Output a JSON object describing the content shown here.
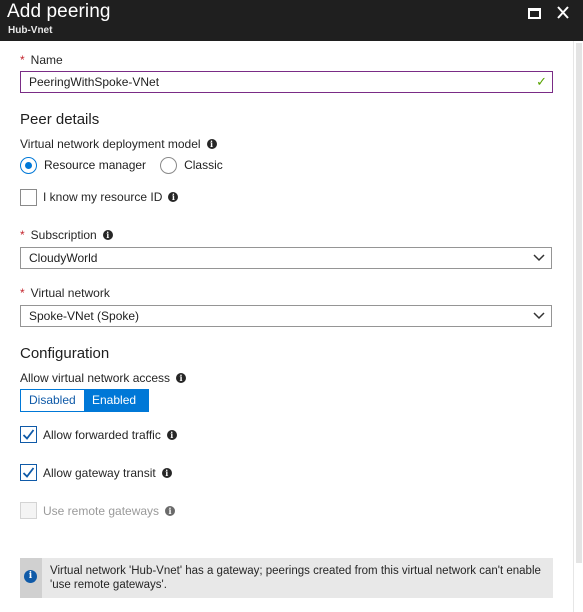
{
  "header": {
    "title": "Add peering",
    "subtitle": "Hub-Vnet"
  },
  "name_field": {
    "label": "Name",
    "required": "*",
    "value": "PeeringWithSpoke-VNet"
  },
  "peer_details": {
    "heading": "Peer details",
    "deployment_model_label": "Virtual network deployment model",
    "options": [
      "Resource manager",
      "Classic"
    ],
    "selected": "Resource manager",
    "resource_id_label": "I know my resource ID",
    "resource_id_checked": false,
    "subscription": {
      "label": "Subscription",
      "required": "*",
      "value": "CloudyWorld"
    },
    "virtual_network": {
      "label": "Virtual network",
      "required": "*",
      "value": "Spoke-VNet (Spoke)"
    }
  },
  "configuration": {
    "heading": "Configuration",
    "access_label": "Allow virtual network access",
    "toggle": {
      "off_label": "Disabled",
      "on_label": "Enabled",
      "selected": "Enabled"
    },
    "forwarded_traffic": {
      "label": "Allow forwarded traffic",
      "checked": true
    },
    "gateway_transit": {
      "label": "Allow gateway transit",
      "checked": true
    },
    "remote_gateways": {
      "label": "Use remote gateways",
      "checked": false,
      "disabled": true
    }
  },
  "banner": {
    "text": "Virtual network 'Hub-Vnet' has a gateway; peerings created from this virtual network can't enable 'use remote gateways'."
  },
  "icons": {
    "info": "info-icon",
    "check": "checkmark-icon",
    "chevron": "chevron-down-icon",
    "maximize": "maximize-icon",
    "close": "close-icon"
  },
  "colors": {
    "accent": "#0078d7",
    "header_bg": "#1f1f1f",
    "required": "#c4262e",
    "valid": "#57a300",
    "textbox_border": "#7a2c86"
  }
}
